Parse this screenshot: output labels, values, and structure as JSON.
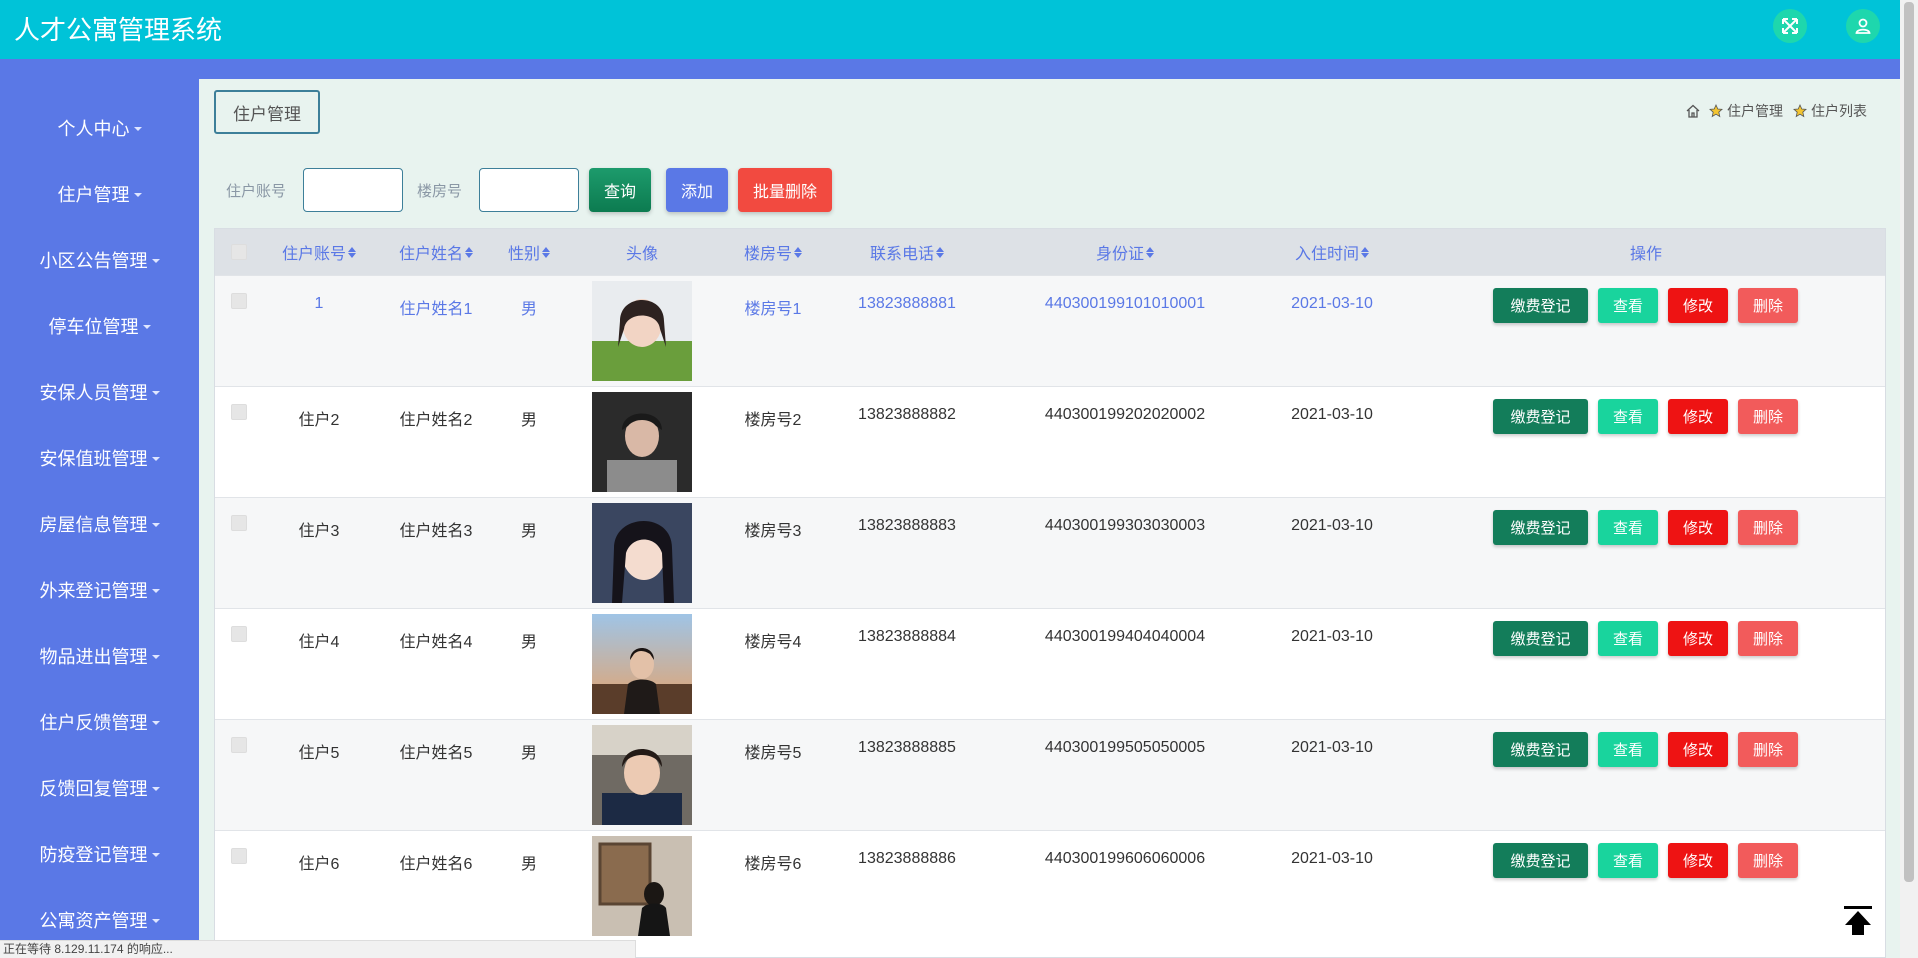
{
  "header": {
    "title": "人才公寓管理系统"
  },
  "sidebar": {
    "items": [
      {
        "label": "个人中心"
      },
      {
        "label": "住户管理"
      },
      {
        "label": "小区公告管理"
      },
      {
        "label": "停车位管理"
      },
      {
        "label": "安保人员管理"
      },
      {
        "label": "安保值班管理"
      },
      {
        "label": "房屋信息管理"
      },
      {
        "label": "外来登记管理"
      },
      {
        "label": "物品进出管理"
      },
      {
        "label": "住户反馈管理"
      },
      {
        "label": "反馈回复管理"
      },
      {
        "label": "防疫登记管理"
      },
      {
        "label": "公寓资产管理"
      }
    ]
  },
  "page": {
    "title_tab": "住户管理",
    "breadcrumb": [
      "住户管理",
      "住户列表"
    ]
  },
  "search": {
    "account_label": "住户账号",
    "account_value": "",
    "building_label": "楼房号",
    "building_value": "",
    "query_label": "查询",
    "add_label": "添加",
    "batch_delete_label": "批量删除"
  },
  "table": {
    "headers": [
      "住户账号",
      "住户姓名",
      "性别",
      "头像",
      "楼房号",
      "联系电话",
      "身份证",
      "入住时间",
      "操作"
    ],
    "rows": [
      {
        "account": "1",
        "name": "住户姓名1",
        "gender": "男",
        "building": "楼房号1",
        "phone": "13823888881",
        "id_card": "440300199101010001",
        "checkin": "2021-03-10"
      },
      {
        "account": "住户2",
        "name": "住户姓名2",
        "gender": "男",
        "building": "楼房号2",
        "phone": "13823888882",
        "id_card": "440300199202020002",
        "checkin": "2021-03-10"
      },
      {
        "account": "住户3",
        "name": "住户姓名3",
        "gender": "男",
        "building": "楼房号3",
        "phone": "13823888883",
        "id_card": "440300199303030003",
        "checkin": "2021-03-10"
      },
      {
        "account": "住户4",
        "name": "住户姓名4",
        "gender": "男",
        "building": "楼房号4",
        "phone": "13823888884",
        "id_card": "440300199404040004",
        "checkin": "2021-03-10"
      },
      {
        "account": "住户5",
        "name": "住户姓名5",
        "gender": "男",
        "building": "楼房号5",
        "phone": "13823888885",
        "id_card": "440300199505050005",
        "checkin": "2021-03-10"
      },
      {
        "account": "住户6",
        "name": "住户姓名6",
        "gender": "男",
        "building": "楼房号6",
        "phone": "13823888886",
        "id_card": "440300199606060006",
        "checkin": "2021-03-10"
      }
    ],
    "actions": {
      "pay": "缴费登记",
      "view": "查看",
      "edit": "修改",
      "delete": "删除"
    }
  },
  "status_bar": {
    "text": "正在等待 8.129.11.174 的响应..."
  },
  "colors": {
    "topbar": "#00c3d8",
    "sidebar": "#5a78e6",
    "accent_green": "#137d5a",
    "danger": "#ee1313"
  },
  "icons": [
    "fullscreen-icon",
    "user-icon",
    "home-icon",
    "star-icon",
    "back-to-top-icon"
  ]
}
